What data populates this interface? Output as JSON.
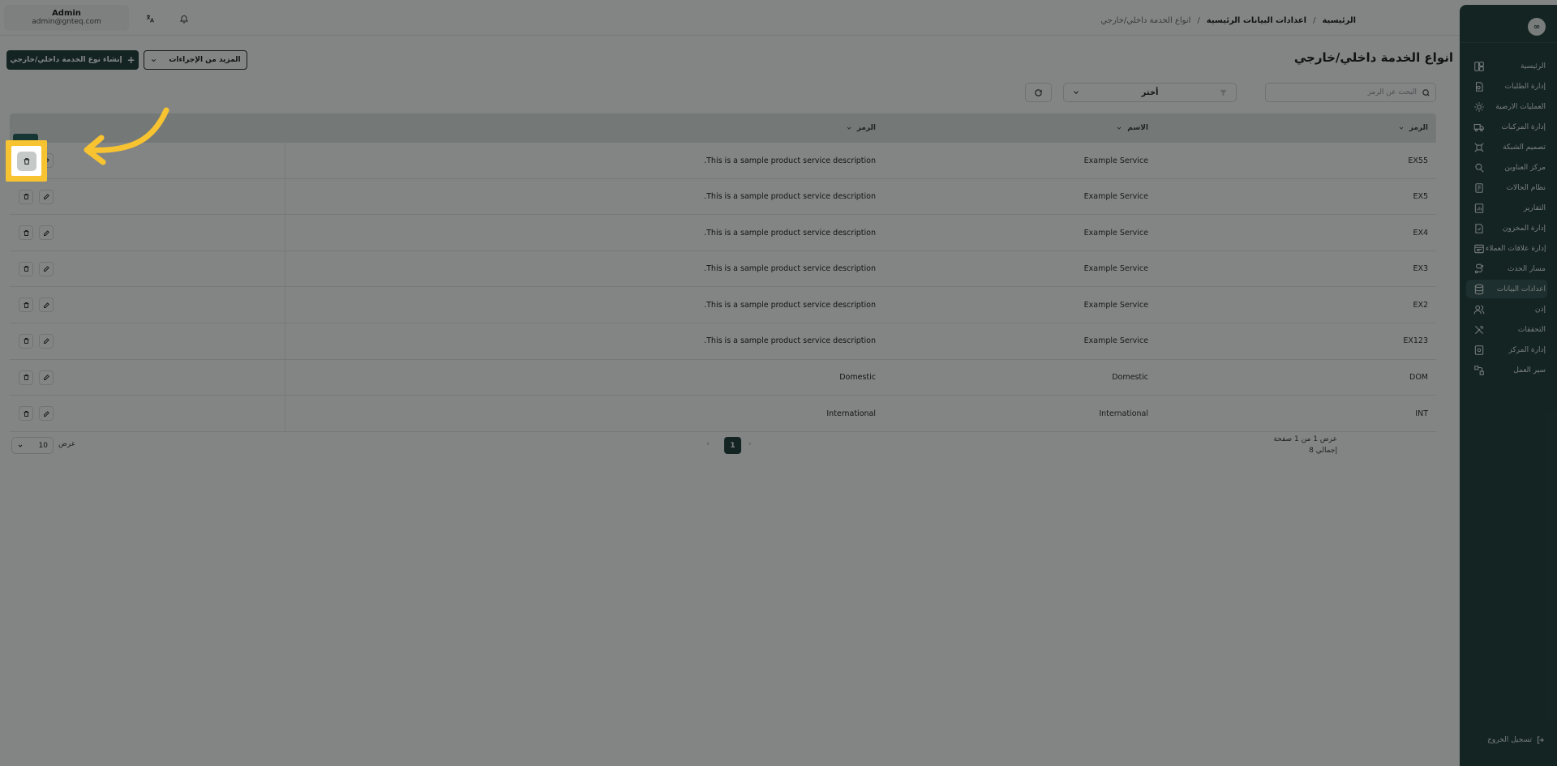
{
  "user": {
    "name": "Admin",
    "email": "admin@gnteq.com"
  },
  "breadcrumb": {
    "home": "الرئيسية",
    "section": "اعدادات البيانات الرئيسية",
    "current": "انواع الخدمة داخلي/خارجي",
    "separator": "/"
  },
  "page": {
    "title": "انواع الخدمة داخلي/خارجي"
  },
  "actions": {
    "create_label": "إنشاء نوع الخدمة داخلي/خارجي",
    "more_label": "المزيد من الإجراءات"
  },
  "filters": {
    "search_placeholder": "البحث عن الرمز",
    "select_value": "أختر"
  },
  "table": {
    "headers": {
      "code": "الرمز",
      "name": "الاسم",
      "description": "الرمز"
    },
    "rows": [
      {
        "code": "EX55",
        "name": "Example Service",
        "description": "This is a sample product service description."
      },
      {
        "code": "EX5",
        "name": "Example Service",
        "description": "This is a sample product service description."
      },
      {
        "code": "EX4",
        "name": "Example Service",
        "description": "This is a sample product service description."
      },
      {
        "code": "EX3",
        "name": "Example Service",
        "description": "This is a sample product service description."
      },
      {
        "code": "EX2",
        "name": "Example Service",
        "description": "This is a sample product service description."
      },
      {
        "code": "EX123",
        "name": "Example Service",
        "description": "This is a sample product service description."
      },
      {
        "code": "DOM",
        "name": "Domestic",
        "description": "Domestic"
      },
      {
        "code": "INT",
        "name": "International",
        "description": "International"
      }
    ]
  },
  "pagination": {
    "page_info": "عرض 1 من 1 صفحة",
    "total": "إجمالي 8",
    "current_page": "1",
    "page_size_label": "عرض",
    "page_size": "10"
  },
  "sidebar": {
    "logo": "∞",
    "items": [
      {
        "label": "الرئيسية",
        "icon": "layout-icon"
      },
      {
        "label": "إدارة الطلبات",
        "icon": "orders-icon"
      },
      {
        "label": "العمليات الارضية",
        "icon": "ground-ops-icon"
      },
      {
        "label": "إدارة المركبات",
        "icon": "truck-icon"
      },
      {
        "label": "تصميم الشبكة",
        "icon": "network-icon"
      },
      {
        "label": "مركز العناوين",
        "icon": "address-icon"
      },
      {
        "label": "نظام الحالات",
        "icon": "status-icon"
      },
      {
        "label": "التقارير",
        "icon": "reports-icon"
      },
      {
        "label": "إدارة المخزون",
        "icon": "inventory-icon"
      },
      {
        "label": "إدارة علاقات العملاء",
        "icon": "crm-icon"
      },
      {
        "label": "مسار الحدث",
        "icon": "route-icon"
      },
      {
        "label": "اعدادات البيانات",
        "icon": "database-icon"
      },
      {
        "label": "إذن",
        "icon": "users-icon"
      },
      {
        "label": "التحققات",
        "icon": "tools-icon"
      },
      {
        "label": "إدارة المركز",
        "icon": "hub-icon"
      },
      {
        "label": "سير العمل",
        "icon": "workflow-icon"
      }
    ],
    "active_index": 11,
    "logout_label": "تسجيل الخروج"
  },
  "colors": {
    "brand": "#163634",
    "highlight": "#f7c331",
    "overlay": "rgba(18,22,22,0.52)"
  }
}
